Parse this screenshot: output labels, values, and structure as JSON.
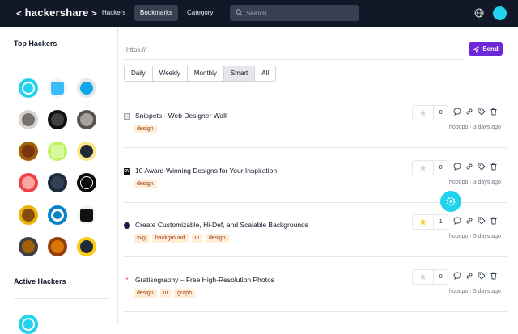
{
  "header": {
    "logo": "hackershare",
    "logo_left": "<",
    "logo_right": ">",
    "nav": [
      "Hackers",
      "Bookmarks",
      "Category"
    ],
    "active_nav": "Bookmarks",
    "search_placeholder": "Search",
    "icons": [
      "globe-icon",
      "user-avatar"
    ]
  },
  "sidebar": {
    "top_hackers_title": "Top Hackers",
    "active_hackers_title": "Active Hackers"
  },
  "composer": {
    "url_placeholder": "https://",
    "send_label": "Send"
  },
  "filters": [
    "Daily",
    "Weekly",
    "Monthly",
    "Smart",
    "All"
  ],
  "active_filter": "Smart",
  "posts": [
    {
      "title": "Snippets - Web Designer Wall",
      "tags": [
        "design"
      ],
      "votes": "0",
      "starred": false,
      "author": "hooopo",
      "time": "3 days ago",
      "favicon": "page"
    },
    {
      "title": "10 Award-Winning Designs for Your Inspiration",
      "tags": [
        "design"
      ],
      "votes": "0",
      "starred": false,
      "author": "hooopo",
      "time": "3 days ago",
      "favicon": "dv"
    },
    {
      "title": "Create Customizable, Hi-Def, and Scalable Backgrounds",
      "tags": [
        "svg",
        "background",
        "ui",
        "design"
      ],
      "votes": "1",
      "starred": true,
      "author": "hooopo",
      "time": "5 days ago",
      "favicon": "dot"
    },
    {
      "title": "Gratisography – Free High-Resolution Photos",
      "tags": [
        "design",
        "ui",
        "graph"
      ],
      "votes": "0",
      "starred": false,
      "author": "hooopo",
      "time": "5 days ago",
      "favicon": "spark"
    }
  ],
  "colors": {
    "topbar": "#111827",
    "accent": "#6d28d9",
    "tag_bg": "#ffedd5",
    "tag_text": "#9a3412",
    "star": "#facc15",
    "avatar_teal": "#22d3ee"
  }
}
